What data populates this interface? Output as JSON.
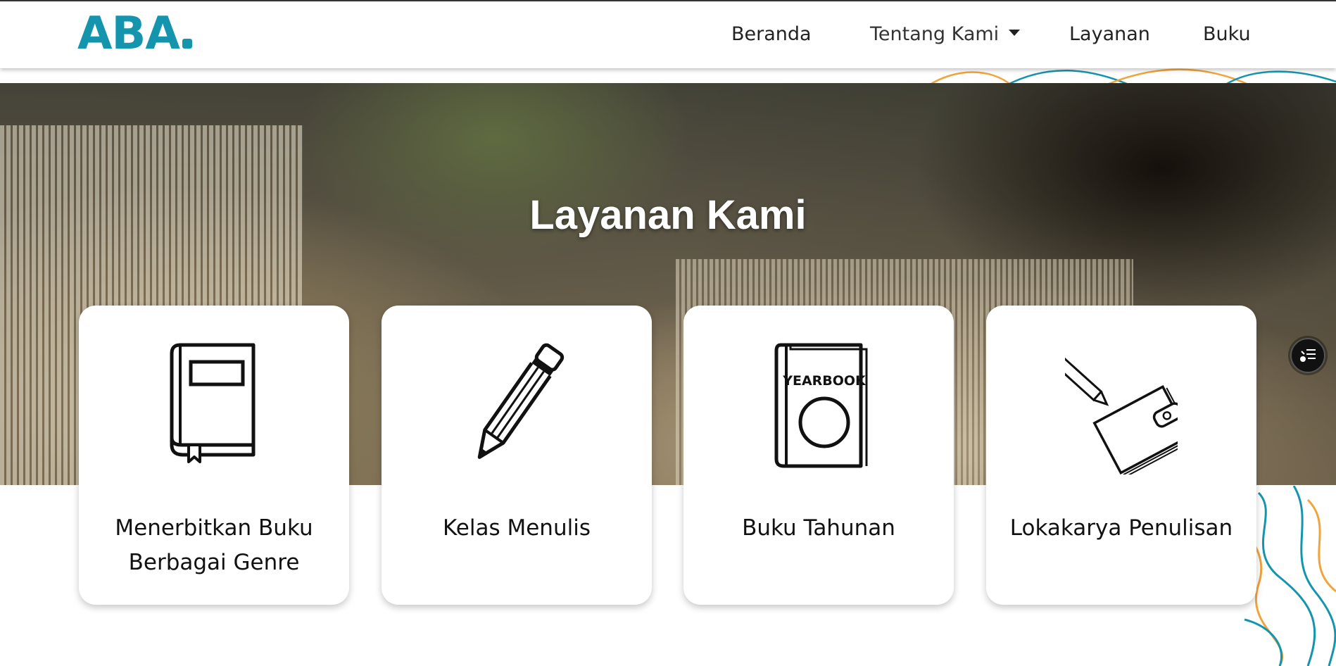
{
  "brand": {
    "logo_text": "ABA",
    "accent_color": "#1595ad"
  },
  "nav": {
    "items": [
      {
        "label": "Beranda"
      },
      {
        "label": "Tentang Kami",
        "has_dropdown": true
      },
      {
        "label": "Layanan"
      },
      {
        "label": "Buku"
      }
    ]
  },
  "hero": {
    "title": "Layanan Kami"
  },
  "services": [
    {
      "label": "Menerbitkan Buku Berbagai Genre",
      "icon": "book-icon"
    },
    {
      "label": "Kelas Menulis",
      "icon": "pencil-icon"
    },
    {
      "label": "Buku Tahunan",
      "icon": "yearbook-icon",
      "icon_text": "YEARBOOK"
    },
    {
      "label": "Lokakarya Penulisan",
      "icon": "notebook-pencil-icon"
    }
  ],
  "floating_button": {
    "icon": "accessibility-menu-icon"
  },
  "decoration_colors": [
    "#f2a33a",
    "#1595ad"
  ]
}
